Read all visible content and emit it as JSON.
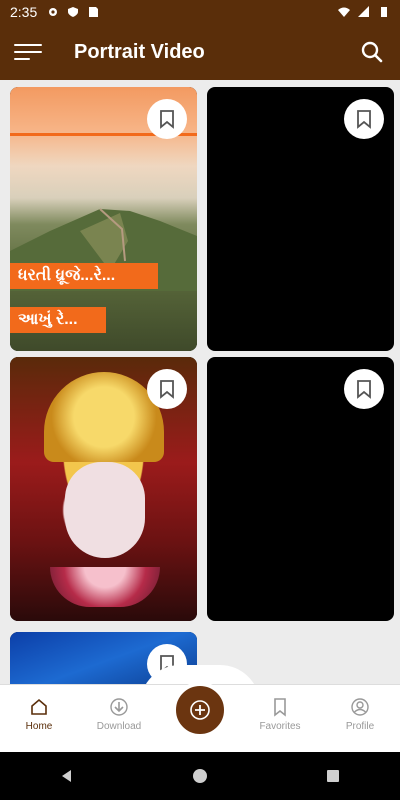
{
  "status": {
    "time": "2:35"
  },
  "app_bar": {
    "title": "Portrait Video"
  },
  "cards": [
    {
      "caption_line1": "ધરતી ધ્રૂજે...રે...",
      "caption_line2": "આખું રે..."
    },
    {},
    {},
    {},
    {}
  ],
  "bottom_nav": {
    "home": "Home",
    "download": "Download",
    "favorites": "Favorites",
    "profile": "Profile"
  },
  "colors": {
    "primary": "#5a2e0a",
    "accent_orange": "#f26a1b"
  },
  "icons": [
    "menu-icon",
    "search-icon",
    "bookmark-icon",
    "home-icon",
    "download-icon",
    "add-icon",
    "profile-icon"
  ]
}
